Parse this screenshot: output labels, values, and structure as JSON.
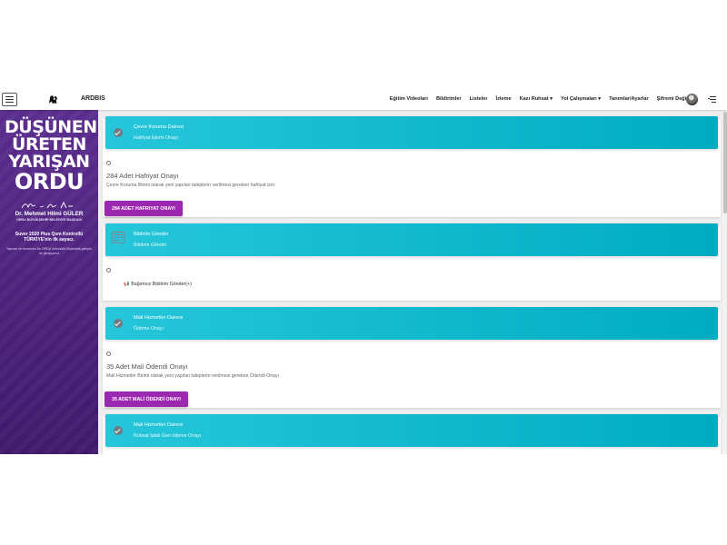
{
  "header": {
    "brand": "ARDBIS",
    "nav": [
      "Eğitim Videoları",
      "Bildirimler",
      "Listeler",
      "İzleme",
      "Kazı Ruhsat",
      "Yol Çalışmaları",
      "Tanımlar/Ayarlar",
      "Şifremi Değiştir"
    ],
    "icons": {
      "menu": "hamburger-icon",
      "logo": "logo-icon",
      "avatar": "avatar",
      "right_menu": "list-menu-icon"
    }
  },
  "sidebar": {
    "slogan": [
      "DÜŞÜNEN",
      "ÜRETEN",
      "YARIŞAN",
      "ORDU"
    ],
    "name": "Dr. Mehmet Hilmi GÜLER",
    "title": "ORDU BÜYÜKŞEHİR BELEDİYE BAŞKANI",
    "text1": "Suver 2020 Plus Qsm Kontrollü TÜRKİYE'nin ilk sayacı.",
    "text2": "Yapılan ve donanımı bir ORDU ürünüdür.Düşündük,çalıştık ve yarışıyoruz"
  },
  "cards": [
    {
      "icon": "check-icon",
      "header_title": "Çevre Koruma Dairesi",
      "header_subtitle": "Hafriyat İşlemi Onayı",
      "count_text": "284 Adet Hafriyat Onayı",
      "description": "Çevre Koruma Birimi olarak yeni yapılan taleplerin verilmesi gereken hafriyat izni",
      "button": "284 ADET HAFRIYAT ONAYI"
    },
    {
      "icon": "calendar-icon",
      "header_title": "Bildirim Gönder",
      "header_subtitle": "Bildirim Gönder",
      "link": "Bağımsız Bildirim Gönder(+)"
    },
    {
      "icon": "check-icon",
      "header_title": "Mali Hizmetler Dairesi",
      "header_subtitle": "Ödeme Onayı",
      "count_text": "35 Adet Mali Ödendi Onayı",
      "description": "Mali Hizmetler Birimi olarak yeni yapılan taleplerin verilmesi gereken Ödendi Onayı",
      "button": "35 ADET MALİ ÖDENDİ ONAYI"
    },
    {
      "icon": "check-icon",
      "header_title": "Mali Hizmetler Dairesi",
      "header_subtitle": "Ruhsat İptali Geri ödeme Onayı"
    }
  ],
  "colors": {
    "header_cyan": "#26c6da",
    "header_cyan_dark": "#00acc1",
    "button_purple": "#9c27b0",
    "sidebar_purple": "#5b2d8e",
    "check_grey": "#6e7b85"
  }
}
